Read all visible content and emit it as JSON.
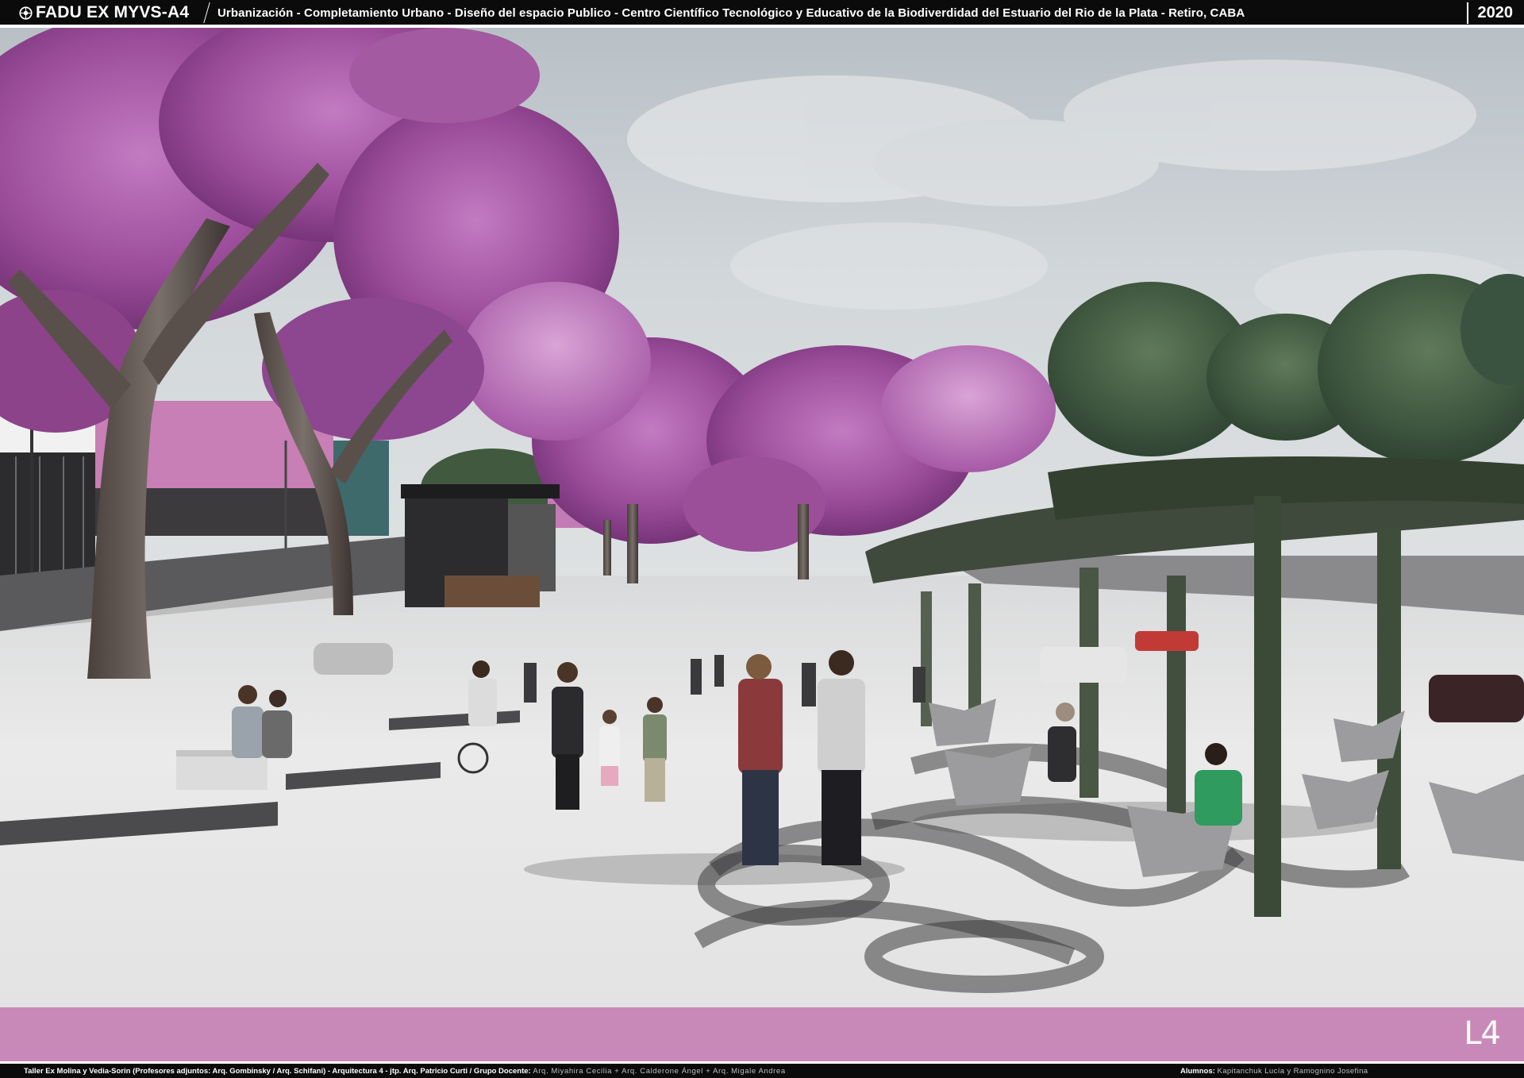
{
  "header": {
    "logo_icon": "circle-emblem-icon",
    "brand": "FADU EX MYVS-A4",
    "subtitle": "Urbanización - Completamiento Urbano - Diseño del espacio Publico - Centro Científico Tecnológico y Educativo de la Biodiverdidad del Estuario del Rio de la Plata   - Retiro, CABA",
    "year": "2020"
  },
  "band": {
    "sheet_label": "L4",
    "color": "#c989b8"
  },
  "footer": {
    "credits_bold": "Taller Ex Molina y Vedia-Sorin (Profesores adjuntos:  Arq. Gombinsky / Arq. Schifani) - Arquitectura 4 - jtp. Arq. Patricio Curti / Grupo Docente:",
    "credits_team": "Arq. Miyahira Cecilia  +  Arq. Calderone Ángel  +  Arq. Migale Andrea",
    "students_label": "Alumnos:",
    "students_names": "Kapitanchuk Lucía  y  Ramognino Josefina"
  },
  "scene": {
    "description_icon": "render-image",
    "colors": {
      "sky": "#c9cfd3",
      "jacaranda": "#a4539f",
      "pavement": "#e6e6e6",
      "building_accent": "#c77fb5"
    }
  }
}
